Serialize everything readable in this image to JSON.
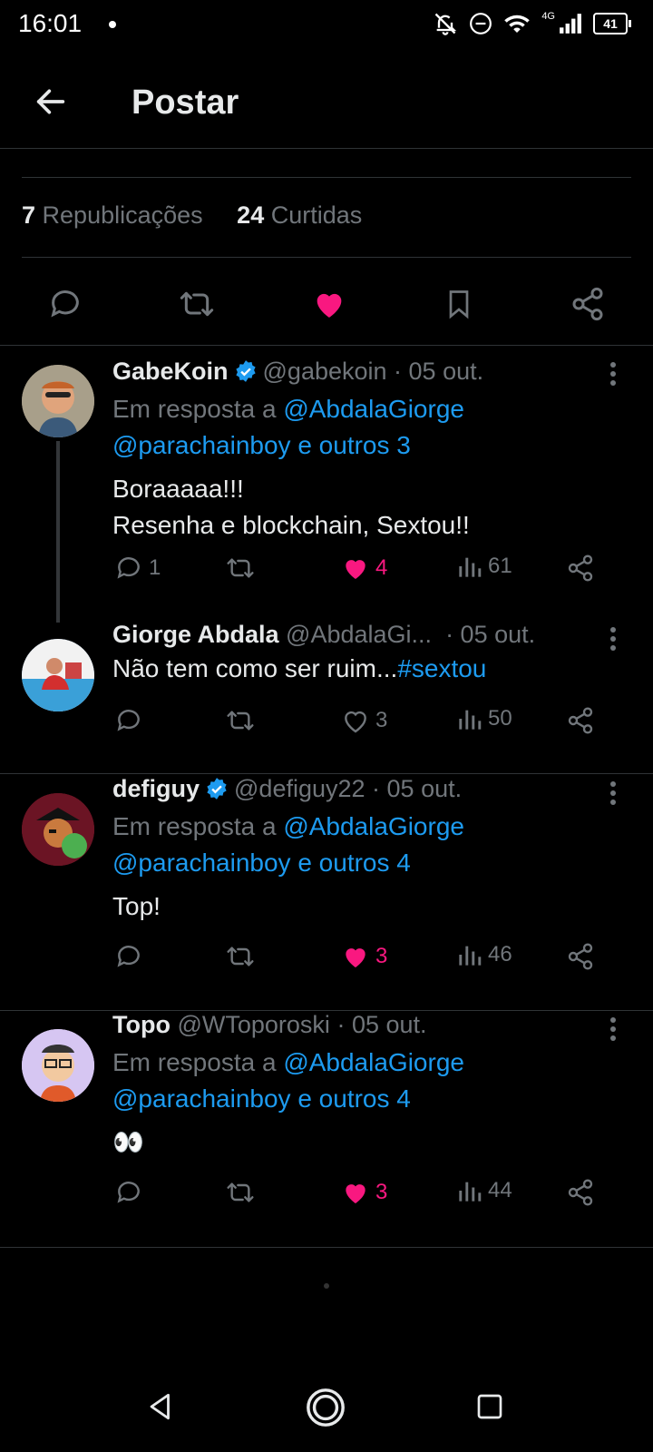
{
  "status": {
    "time": "16:01",
    "network": "4G",
    "battery": "41"
  },
  "header": {
    "title": "Postar"
  },
  "stats": {
    "reposts_count": "7",
    "reposts_label": "Republicações",
    "likes_count": "24",
    "likes_label": "Curtidas"
  },
  "colors": {
    "accent": "#1d9bf0",
    "like": "#f91880",
    "bg": "#000000"
  },
  "replies": [
    {
      "name": "GabeKoin",
      "handle": "@gabekoin",
      "date": "· 05 out.",
      "reply_prefix": "Em resposta a",
      "reply_mention": "@AbdalaGiorge",
      "reply_rest": "@parachainboy e outros 3",
      "body_line1": "Boraaaaa!!!",
      "body_line2": "Resenha e blockchain, Sextou!!",
      "replies": "1",
      "likes": "4",
      "views": "61"
    },
    {
      "name": "Giorge Abdala",
      "handle": "@AbdalaGi...",
      "date": "· 05 out.",
      "body_text": "Não tem como ser ruim...",
      "body_hashtag": "#sextou",
      "likes": "3",
      "views": "50"
    },
    {
      "name": "defiguy",
      "handle": "@defiguy22",
      "date": "· 05 out.",
      "reply_prefix": "Em resposta a",
      "reply_mention": "@AbdalaGiorge",
      "reply_rest": "@parachainboy e outros 4",
      "body_line1": "Top!",
      "likes": "3",
      "views": "46"
    },
    {
      "name": "Topo",
      "handle": "@WToporoski",
      "date": "· 05 out.",
      "reply_prefix": "Em resposta a",
      "reply_mention": "@AbdalaGiorge",
      "reply_rest": "@parachainboy e outros 4",
      "body_line1": "👀",
      "likes": "3",
      "views": "44"
    }
  ]
}
